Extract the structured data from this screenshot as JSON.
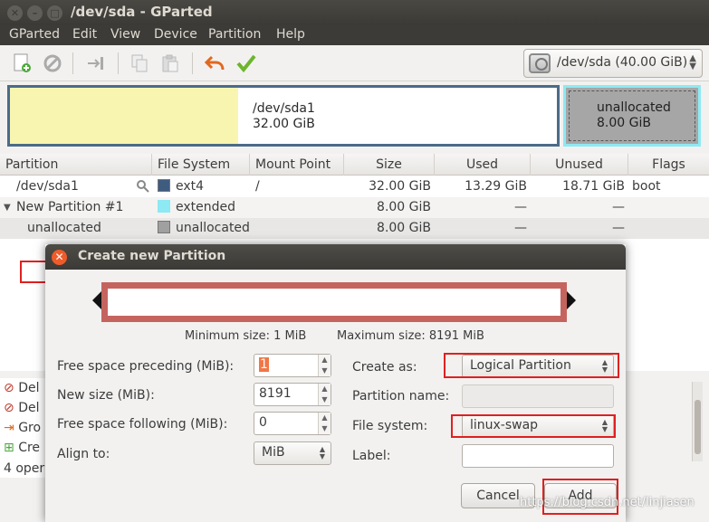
{
  "window": {
    "title": "/dev/sda - GParted"
  },
  "menubar": [
    "GParted",
    "Edit",
    "View",
    "Device",
    "Partition",
    "Help"
  ],
  "toolbar": {
    "device_label": "/dev/sda   (40.00 GiB)",
    "icons": [
      "new-partition-icon",
      "delete-icon",
      "resize-move-icon",
      "copy-icon",
      "paste-icon",
      "undo-icon",
      "apply-icon"
    ]
  },
  "diskmap": {
    "sda1_name": "/dev/sda1",
    "sda1_size": "32.00 GiB",
    "unalloc_name": "unallocated",
    "unalloc_size": "8.00 GiB"
  },
  "table": {
    "headers": [
      "Partition",
      "File System",
      "Mount Point",
      "Size",
      "Used",
      "Unused",
      "Flags"
    ],
    "rows": [
      {
        "partition": "/dev/sda1",
        "fs": "ext4",
        "fs_color": "#3e5c80",
        "mount": "/",
        "size": "32.00 GiB",
        "used": "13.29 GiB",
        "unused": "18.71 GiB",
        "flags": "boot"
      },
      {
        "partition": "New Partition #1",
        "fs": "extended",
        "fs_color": "#8de9f3",
        "mount": "",
        "size": "8.00 GiB",
        "used": "—",
        "unused": "—",
        "flags": ""
      },
      {
        "partition": "unallocated",
        "fs": "unallocated",
        "fs_color": "#a0a0a0",
        "mount": "",
        "size": "8.00 GiB",
        "used": "—",
        "unused": "—",
        "flags": ""
      }
    ]
  },
  "operations": {
    "items": [
      "Del",
      "Del",
      "Gro",
      "Cre"
    ],
    "status": "4 opera"
  },
  "dialog": {
    "title": "Create new Partition",
    "min_size": "Minimum size: 1 MiB",
    "max_size": "Maximum size: 8191 MiB",
    "free_preceding_label": "Free space preceding (MiB):",
    "free_preceding_value": "1",
    "new_size_label": "New size (MiB):",
    "new_size_value": "8191",
    "free_following_label": "Free space following (MiB):",
    "free_following_value": "0",
    "align_label": "Align to:",
    "align_value": "MiB",
    "create_as_label": "Create as:",
    "create_as_value": "Logical Partition",
    "partition_name_label": "Partition name:",
    "file_system_label": "File system:",
    "file_system_value": "linux-swap",
    "label_label": "Label:",
    "cancel": "Cancel",
    "add": "Add"
  },
  "watermark": "https://blog.csdn.net/linjiasen"
}
